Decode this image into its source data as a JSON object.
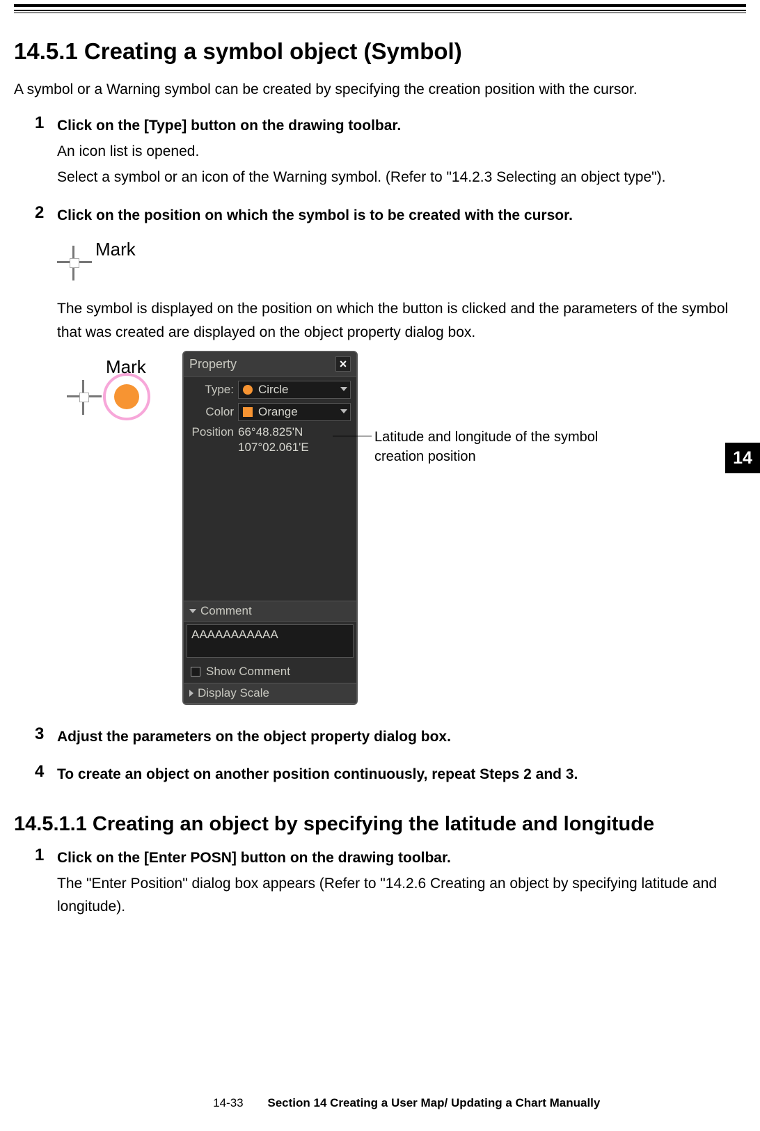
{
  "section_tab": "14",
  "heading1": "14.5.1   Creating a symbol object (Symbol)",
  "intro1": "A symbol or a Warning symbol can be created by specifying the creation position with the cursor.",
  "sec1_steps": {
    "s1": {
      "title": "Click on the [Type] button on the drawing toolbar.",
      "line1": "An icon list is opened.",
      "line2": "Select a symbol or an icon of the Warning symbol. (Refer to \"14.2.3 Selecting an object type\")."
    },
    "s2": {
      "title": "Click on the position on which the symbol is to be created with the cursor.",
      "after": "The symbol is displayed on the position on which the button is clicked and the parameters of the symbol that was created are displayed on the object property dialog box."
    },
    "s3": {
      "title": "Adjust the parameters on the object property dialog box."
    },
    "s4": {
      "title": "To create an object on another position continuously, repeat Steps 2 and 3."
    }
  },
  "cursor_label": "Mark",
  "mark_label": "Mark",
  "property_dialog": {
    "title": "Property",
    "type_label": "Type:",
    "type_value": "Circle",
    "color_label": "Color",
    "color_value": "Orange",
    "position_label": "Position",
    "position_lat": "66°48.825'N",
    "position_lon": "107°02.061'E",
    "comment_header": "Comment",
    "comment_text": "AAAAAAAAAAA",
    "show_comment_label": "Show Comment",
    "display_scale_header": "Display Scale"
  },
  "callout_text": "Latitude and longitude of the symbol creation position",
  "heading2": "14.5.1.1    Creating an object by specifying the latitude and longitude",
  "sec2_steps": {
    "s1": {
      "title": "Click on the [Enter POSN] button on the drawing toolbar.",
      "body": "The \"Enter Position\" dialog box appears (Refer to \"14.2.6 Creating an object by specifying latitude and longitude)."
    }
  },
  "footer": {
    "page": "14-33",
    "text": "Section 14    Creating a User Map/ Updating a Chart Manually"
  }
}
